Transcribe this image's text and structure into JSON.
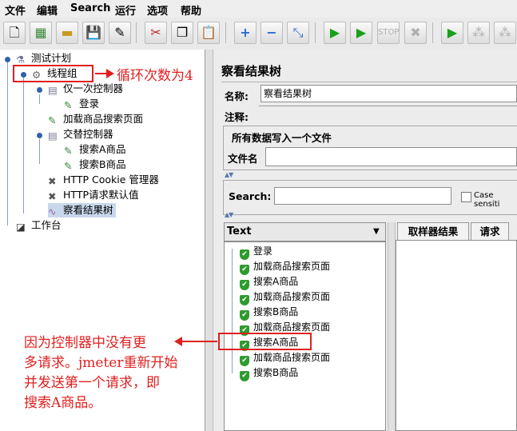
{
  "menu": [
    "文件",
    "编辑",
    "Search",
    "运行",
    "选项",
    "帮助"
  ],
  "tree": {
    "root": "测试计划",
    "thread_group": "线程组",
    "once_controller": "仅一次控制器",
    "login": "登录",
    "load_search_page": "加载商品搜索页面",
    "interleave_controller": "交替控制器",
    "search_a": "搜索A商品",
    "search_b": "搜索B商品",
    "cookie_manager": "HTTP Cookie 管理器",
    "http_defaults": "HTTP请求默认值",
    "view_results_tree": "察看结果树",
    "workbench": "工作台"
  },
  "panel": {
    "title": "察看结果树",
    "name_label": "名称:",
    "name_value": "察看结果树",
    "comment_label": "注释:",
    "write_all_label": "所有数据写入一个文件",
    "filename_label": "文件名",
    "search_label": "Search:",
    "case_label": "Case sensiti",
    "renderer_value": "Text",
    "tab_sampler": "取样器结果",
    "tab_request": "请求"
  },
  "results": [
    "登录",
    "加载商品搜索页面",
    "搜索A商品",
    "加载商品搜索页面",
    "搜索B商品",
    "加载商品搜索页面",
    "搜索A商品",
    "加载商品搜索页面",
    "搜索B商品"
  ],
  "annotations": {
    "loop_note": "循环次数为4",
    "explain_1": "因为控制器中没有更",
    "explain_2": "多请求。jmeter重新开始",
    "explain_3": "并发送第一个请求，即",
    "explain_4": "搜索A商品。"
  },
  "colors": {
    "annotation": "#e02020",
    "success": "#2e9b2e",
    "selection": "#c8d8ec"
  }
}
